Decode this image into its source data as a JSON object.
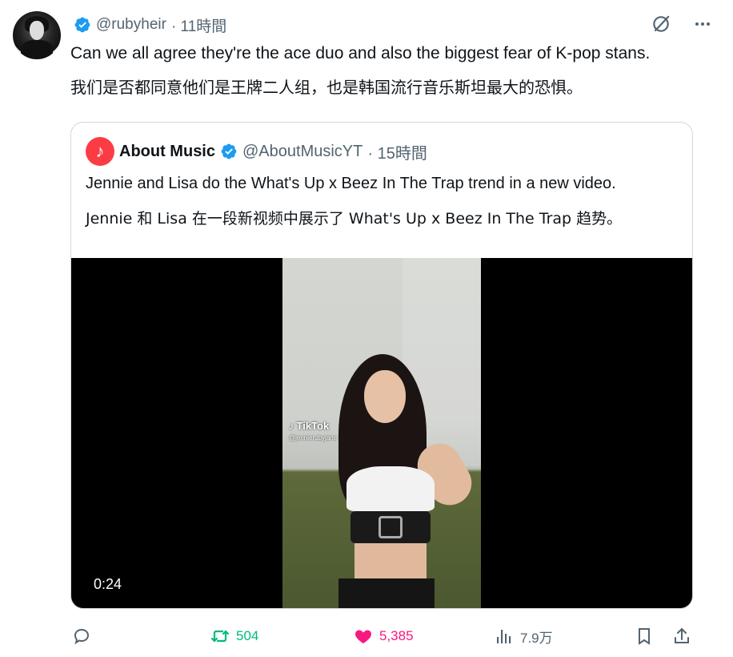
{
  "post": {
    "handle": "@rubyheir",
    "time": "· 11時間",
    "text_en": "Can we all agree they're the ace duo and also the biggest fear of K-pop stans.",
    "text_zh": "我们是否都同意他们是王牌二人组，也是韩国流行音乐斯坦最大的恐惧。"
  },
  "quote": {
    "name": "About Music",
    "handle": "@AboutMusicYT",
    "time": "· 15時間",
    "text_en": "Jennie and Lisa do the What's Up x Beez In The Trap trend in a new video.",
    "text_zh": "Jennie 和 Lisa 在一段新视频中展示了 What's Up x Beez In The Trap 趋势。",
    "video": {
      "watermark": "TikTok",
      "watermark_user": "@jennierubyjane",
      "duration": "0:24"
    }
  },
  "actions": {
    "retweets": "504",
    "likes": "5,385",
    "views": "7.9万"
  },
  "colors": {
    "accent_blue": "#1d9bf0",
    "retweet_green": "#00ba7c",
    "like_pink": "#f91880",
    "muted": "#536471"
  }
}
